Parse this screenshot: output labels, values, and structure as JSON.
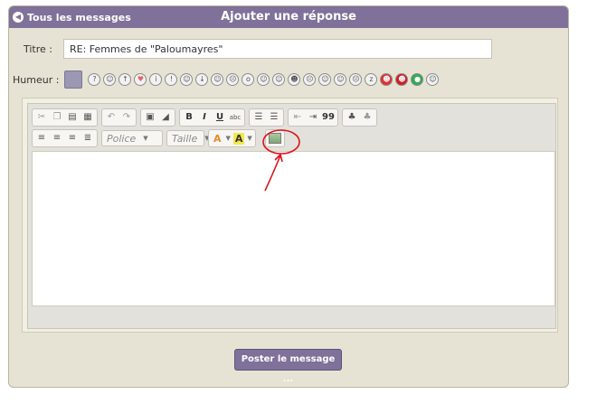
{
  "header": {
    "back_label": "Tous les messages",
    "title": "Ajouter une réponse"
  },
  "form": {
    "title_label": "Titre :",
    "title_value": "RE: Femmes de \"Paloumayres\"",
    "mood_label": "Humeur :",
    "mood_selected_color": "#9b98b3",
    "mood_icons": [
      "question-icon",
      "smile-icon",
      "thumbs-up-icon",
      "heart-icon",
      "info-icon",
      "warning-icon",
      "wink-icon",
      "thumbs-down-icon",
      "grin-icon",
      "sad-icon",
      "surprised-icon",
      "tongue-icon",
      "laugh-icon",
      "cool-icon",
      "angry-icon",
      "neutral-icon",
      "confused-icon",
      "cry-icon",
      "sleepy-icon",
      "devil-icon",
      "evil-icon",
      "world-icon",
      "crazy-icon"
    ]
  },
  "editor": {
    "toolbar_row1": {
      "group1": [
        "cut-icon",
        "copy-icon",
        "paste-icon",
        "paste-word-icon"
      ],
      "group2": [
        "undo-icon",
        "redo-icon"
      ],
      "group3": [
        "select-all-icon",
        "eraser-icon"
      ],
      "bold": "B",
      "italic": "I",
      "underline": "U",
      "strike": "abc",
      "lists": [
        "ordered-list-icon",
        "bullet-list-icon"
      ],
      "indent": [
        "outdent-icon",
        "indent-icon"
      ],
      "quote": "99",
      "extra": [
        "spoiler-icon",
        "hide-icon"
      ]
    },
    "toolbar_row2": {
      "align": [
        "align-left-icon",
        "align-center-icon",
        "align-right-icon",
        "justify-icon"
      ],
      "font_placeholder": "Police",
      "size_placeholder": "Taille",
      "text_color_label": "A",
      "bg_color_label": "A",
      "image_icon": "insert-image-icon"
    },
    "annotation_color": "#e0101a"
  },
  "submit": {
    "label": "Poster le message ..."
  },
  "colors": {
    "accent": "#7f7199",
    "panel": "#e7e3d4"
  }
}
